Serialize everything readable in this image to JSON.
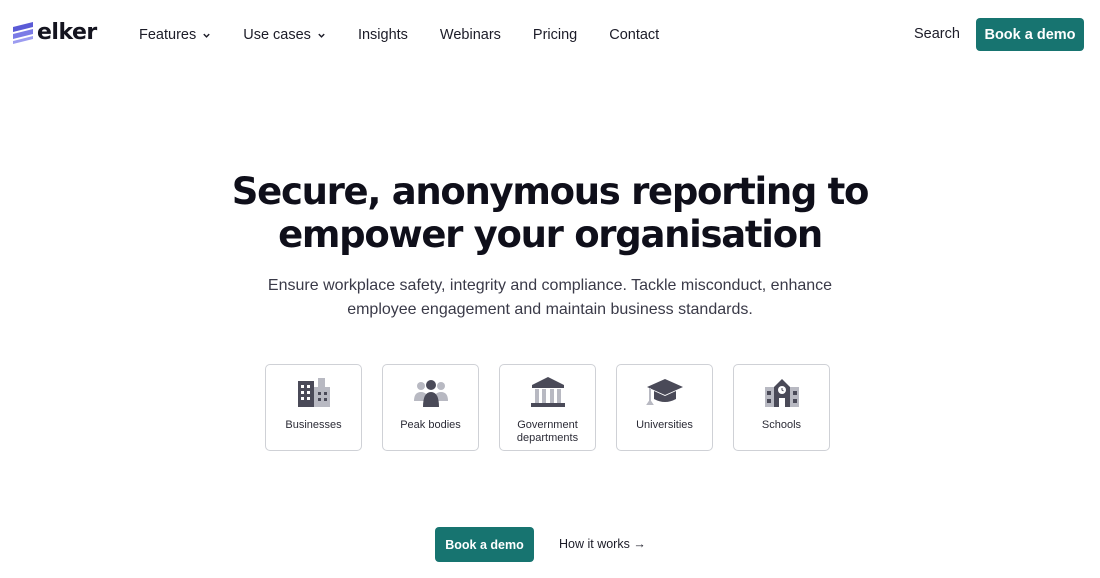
{
  "brand": {
    "name": "elker",
    "colors": {
      "accent": "#177470",
      "logo": "#5b5bd6",
      "icon": "#4a4a58"
    }
  },
  "nav": {
    "items": [
      {
        "label": "Features",
        "dropdown": true
      },
      {
        "label": "Use cases",
        "dropdown": true
      },
      {
        "label": "Insights",
        "dropdown": false
      },
      {
        "label": "Webinars",
        "dropdown": false
      },
      {
        "label": "Pricing",
        "dropdown": false
      },
      {
        "label": "Contact",
        "dropdown": false
      }
    ],
    "search_label": "Search",
    "cta_label": "Book a demo"
  },
  "hero": {
    "title_line1": "Secure, anonymous reporting to",
    "title_line2": "empower your organisation",
    "subtitle_line1": "Ensure workplace safety, integrity and compliance. Tackle misconduct, enhance",
    "subtitle_line2": "employee engagement and maintain business standards."
  },
  "cards": [
    {
      "label": "Businesses",
      "icon": "office-buildings-icon"
    },
    {
      "label": "Peak bodies",
      "icon": "people-group-icon"
    },
    {
      "label_line1": "Government",
      "label_line2": "departments",
      "icon": "government-building-icon"
    },
    {
      "label": "Universities",
      "icon": "graduation-cap-icon"
    },
    {
      "label": "Schools",
      "icon": "school-building-icon"
    }
  ],
  "cta": {
    "primary_label": "Book a demo",
    "secondary_label": "How it works →"
  }
}
